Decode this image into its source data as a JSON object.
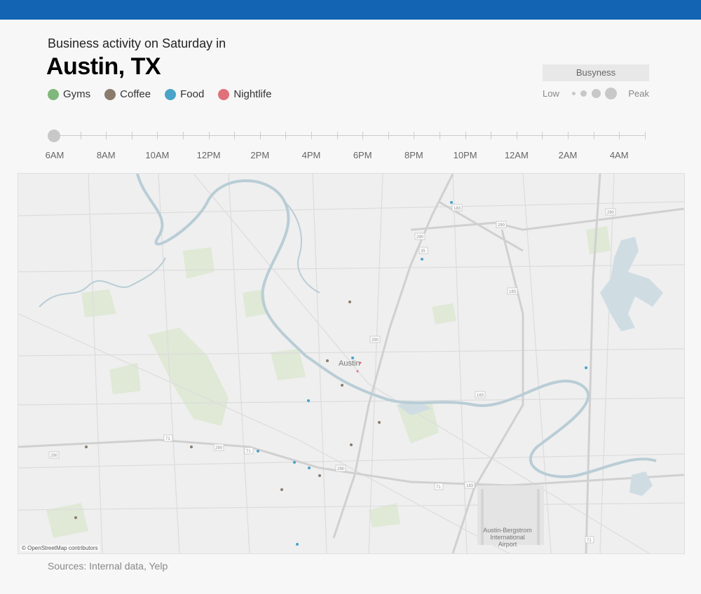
{
  "header": {
    "subtitle": "Business activity on Saturday in",
    "title": "Austin, TX"
  },
  "legend": [
    {
      "label": "Gyms",
      "color": "#7fb87a",
      "icon": "gyms-dot-icon"
    },
    {
      "label": "Coffee",
      "color": "#8a7b6d",
      "icon": "coffee-dot-icon"
    },
    {
      "label": "Food",
      "color": "#4aa3c8",
      "icon": "food-dot-icon"
    },
    {
      "label": "Nightlife",
      "color": "#e0707a",
      "icon": "nightlife-dot-icon"
    }
  ],
  "busyness": {
    "title": "Busyness",
    "low": "Low",
    "peak": "Peak"
  },
  "timeline": {
    "labels": [
      "6AM",
      "8AM",
      "10AM",
      "12PM",
      "2PM",
      "4PM",
      "6PM",
      "8PM",
      "10PM",
      "12AM",
      "2AM",
      "4AM"
    ],
    "selected": "6AM"
  },
  "map": {
    "city_label": "Austin",
    "airport_label": [
      "Austin-Bergstrom",
      "International",
      "Airport"
    ],
    "highway_shields": [
      "183",
      "290",
      "290",
      "290",
      "290",
      "183",
      "183",
      "290",
      "71",
      "290",
      "71",
      "71",
      "183",
      "71",
      "290",
      "35"
    ],
    "attribution": "© OpenStreetMap contributors"
  },
  "footer": {
    "sources": "Sources: Internal data, Yelp"
  }
}
